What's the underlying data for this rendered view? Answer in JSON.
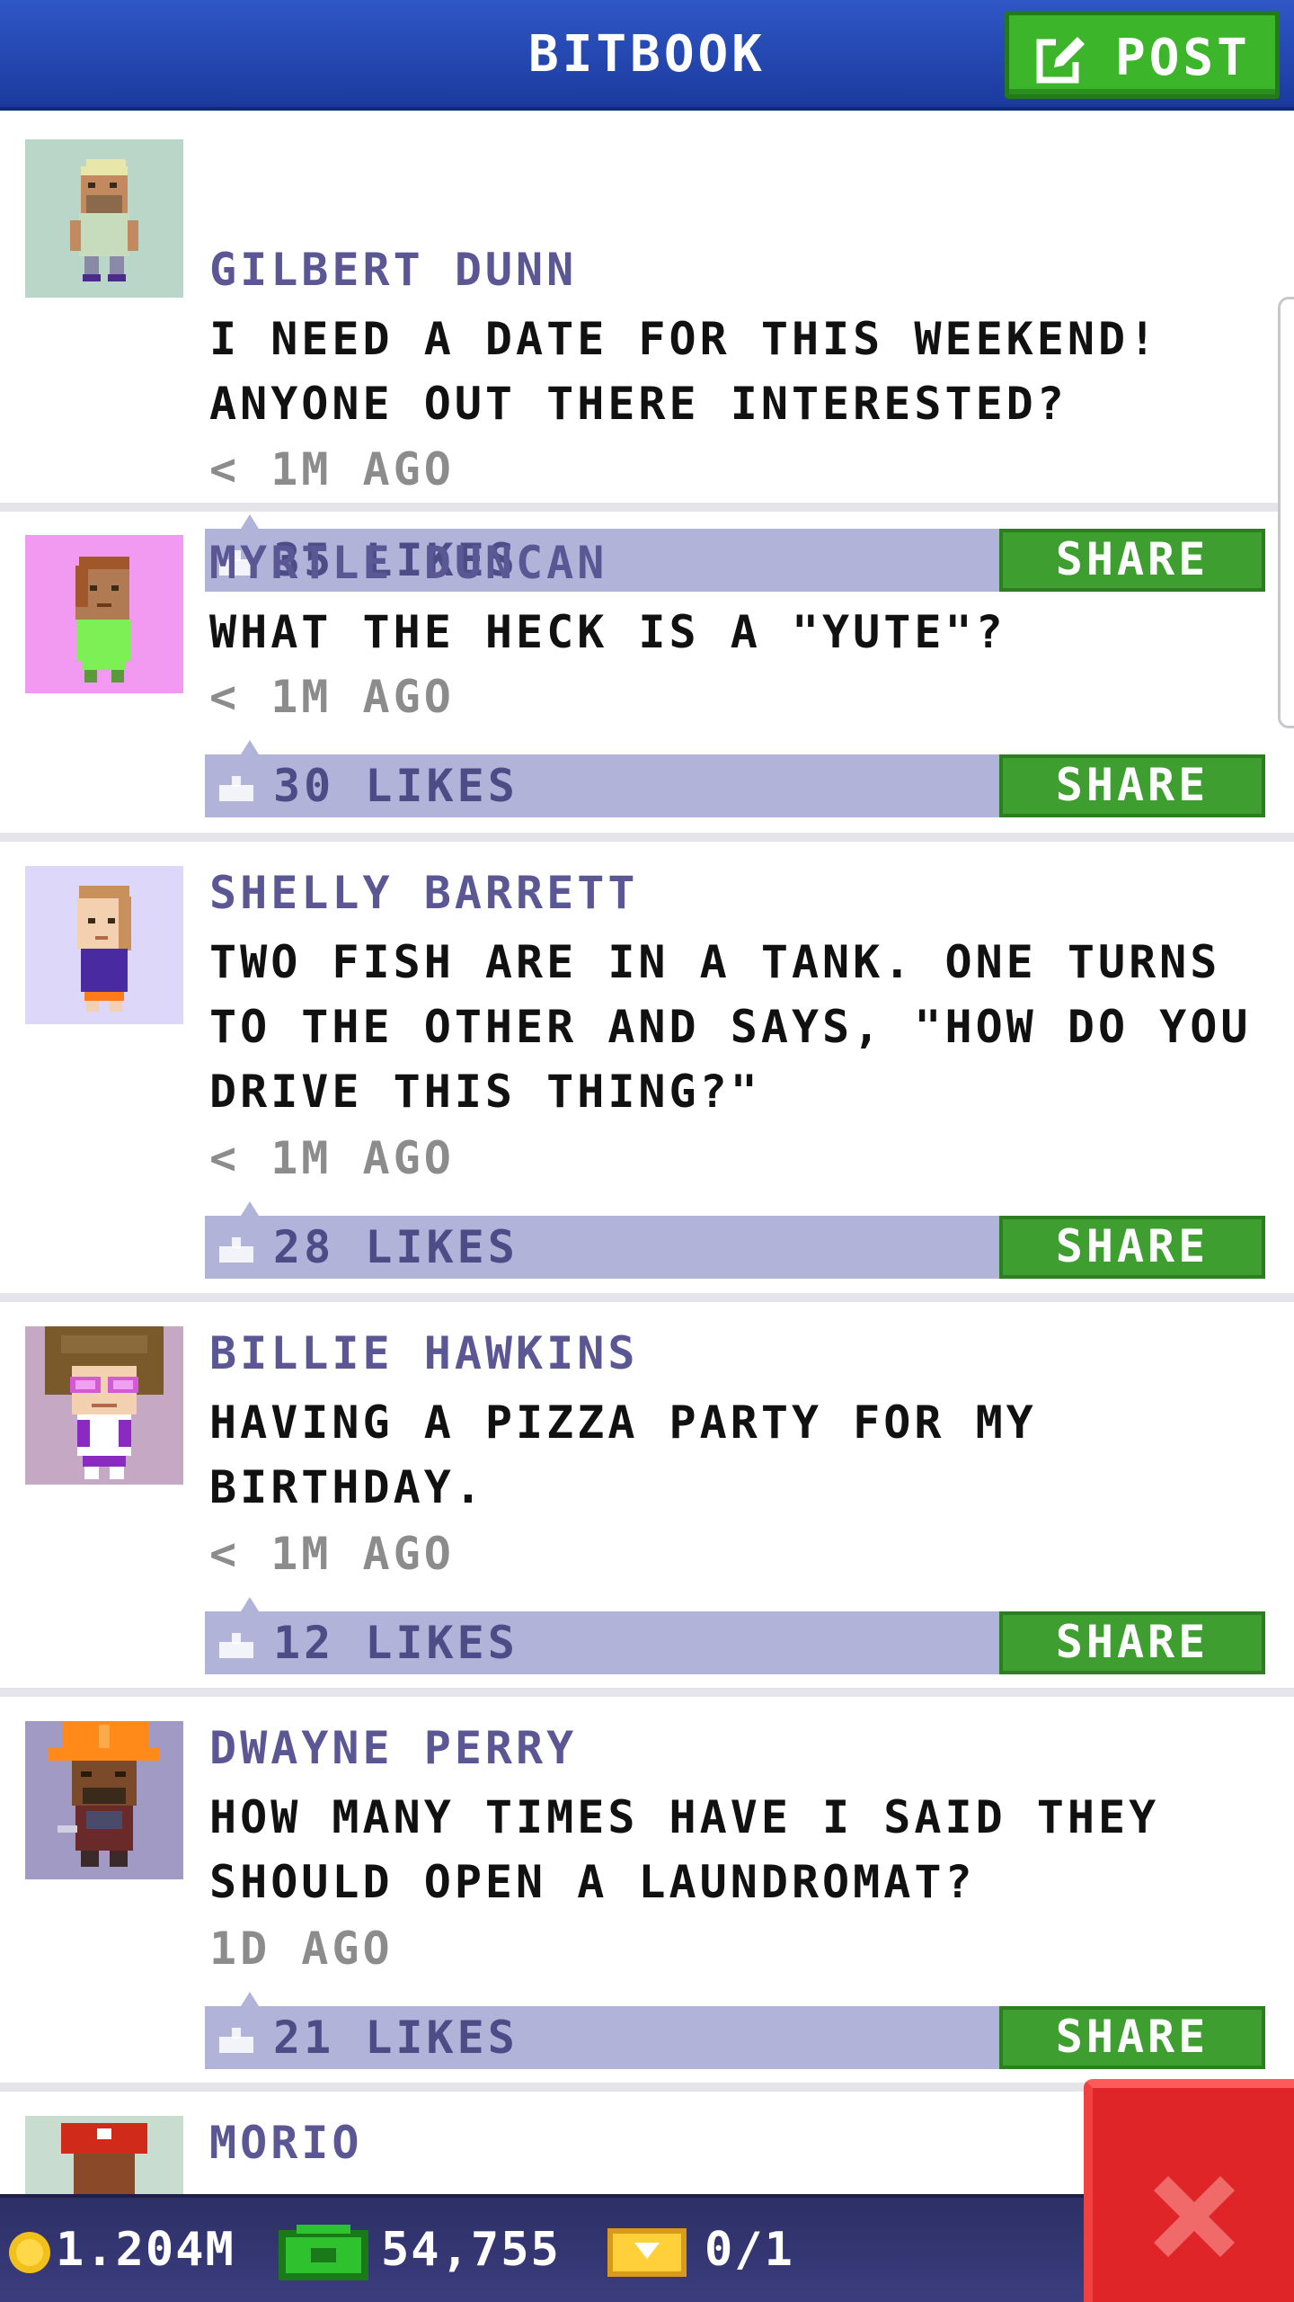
{
  "header": {
    "title": "BITBOOK",
    "post_label": "POST"
  },
  "posts": [
    {
      "author": "GILBERT DUNN",
      "message": "I NEED A DATE FOR THIS WEEKEND! ANYONE OUT THERE INTERESTED?",
      "time": "< 1M AGO",
      "likes": "35 LIKES",
      "share_label": "SHARE",
      "avatar_bg": "#b9d6c8"
    },
    {
      "author": "MYRTLE DUNCAN",
      "message": "WHAT THE HECK IS A \"YUTE\"?",
      "time": "< 1M AGO",
      "likes": "30 LIKES",
      "share_label": "SHARE",
      "avatar_bg": "#f29af2"
    },
    {
      "author": "SHELLY BARRETT",
      "message": "TWO FISH ARE IN A TANK. ONE TURNS TO THE OTHER AND SAYS, \"HOW DO YOU DRIVE THIS THING?\"",
      "time": "< 1M AGO",
      "likes": "28 LIKES",
      "share_label": "SHARE",
      "avatar_bg": "#ddd8fa"
    },
    {
      "author": "BILLIE HAWKINS",
      "message": "HAVING A PIZZA PARTY FOR MY BIRTHDAY.",
      "time": "< 1M AGO",
      "likes": "12 LIKES",
      "share_label": "SHARE",
      "avatar_bg": "#c4a8c4"
    },
    {
      "author": "DWAYNE PERRY",
      "message": "HOW MANY TIMES HAVE I SAID THEY SHOULD OPEN A LAUNDROMAT?",
      "time": "1D AGO",
      "likes": "21 LIKES",
      "share_label": "SHARE",
      "avatar_bg": "#a09ac4"
    },
    {
      "author": "MORIO",
      "avatar_bg": "#c8dcd0"
    }
  ],
  "status": {
    "coins": "1.204M",
    "cash": "54,755",
    "tickets": "0/1"
  },
  "colors": {
    "header_blue": "#2448b8",
    "post_green": "#3cb52a",
    "like_bar": "#b1b4d8",
    "share_green": "#3f9e30",
    "author_purple": "#5a5794",
    "close_red": "#e02529"
  },
  "icons": {
    "post": "edit-icon",
    "like": "thumbs-up-icon",
    "coin": "coin-icon",
    "cash": "cash-icon",
    "ticket": "ticket-icon",
    "close": "close-icon"
  }
}
